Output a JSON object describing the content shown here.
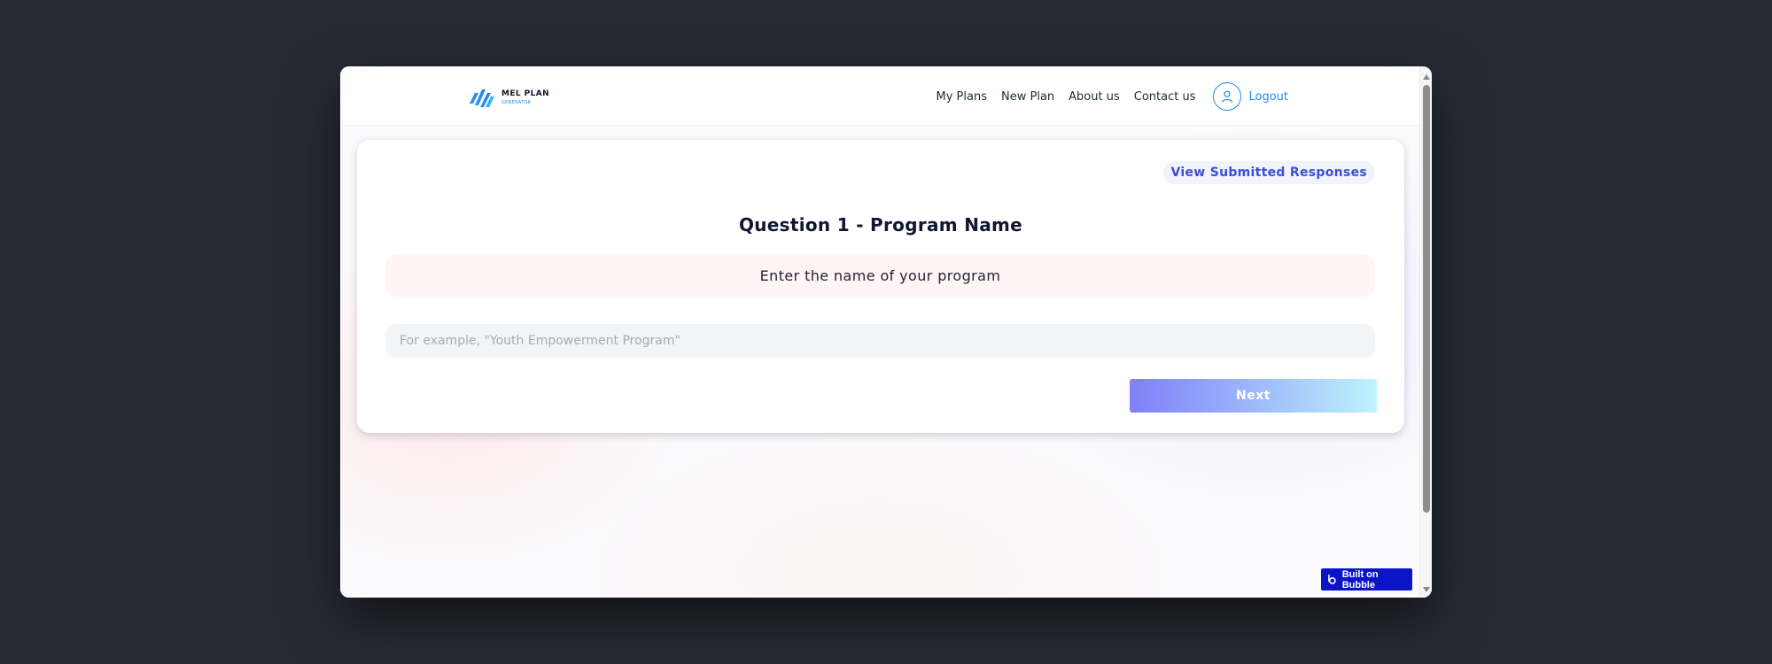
{
  "header": {
    "logo": {
      "title": "MEL PLAN",
      "subtitle": "GENERATOR",
      "colors": {
        "primary": "#1f8cf0",
        "dark": "#111827"
      }
    },
    "nav": [
      {
        "label": "My Plans"
      },
      {
        "label": "New Plan"
      },
      {
        "label": "About us"
      },
      {
        "label": "Contact us"
      }
    ],
    "user": {
      "icon": "user-icon",
      "logout_label": "Logout"
    }
  },
  "card": {
    "view_responses_label": "View Submitted Responses",
    "question_title": "Question 1 - Program Name",
    "prompt": "Enter the name of your program",
    "input": {
      "value": "",
      "placeholder": "For example, \"Youth Empowerment Program\""
    },
    "next_label": "Next"
  },
  "badge": {
    "label": "Built on Bubble",
    "icon": "bubble-icon"
  },
  "colors": {
    "accent": "#1f8cf0",
    "title": "#101531",
    "view_button_text": "#3b4fd8",
    "badge_bg": "#0c14c8"
  }
}
